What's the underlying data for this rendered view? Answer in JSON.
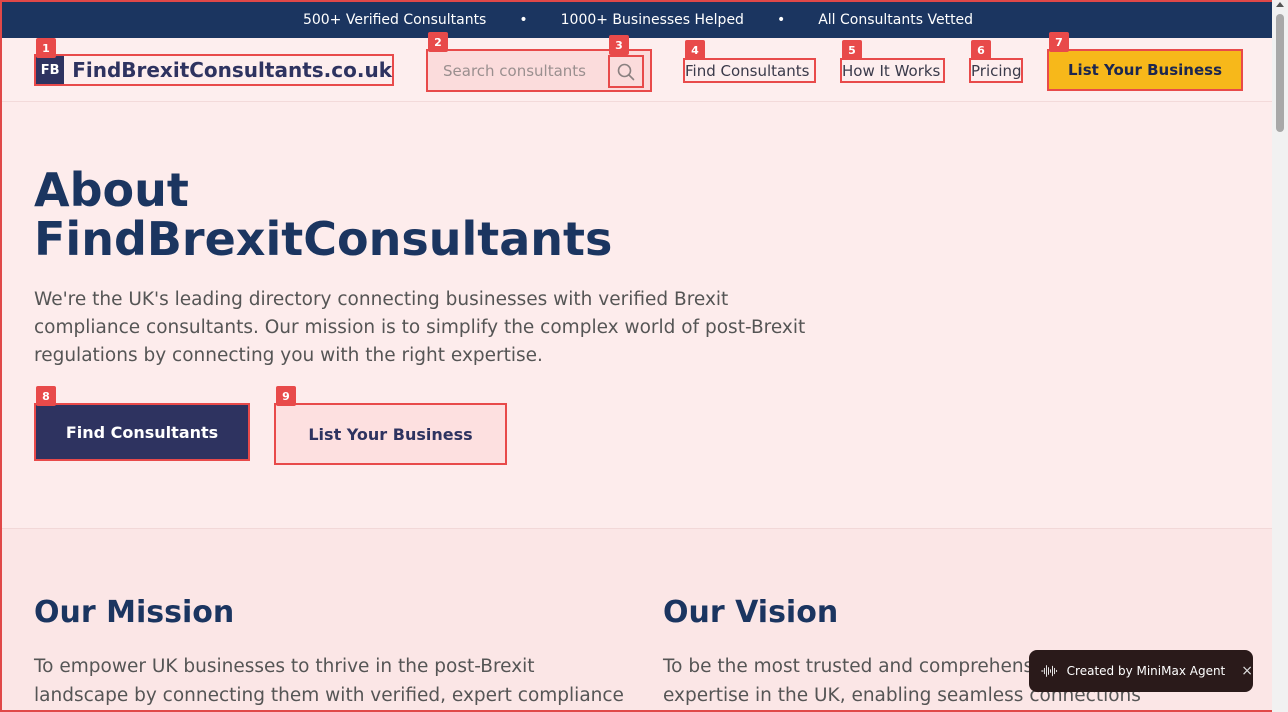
{
  "topbar": {
    "item1": "500+ Verified Consultants",
    "item2": "1000+ Businesses Helped",
    "item3": "All Consultants Vetted",
    "separator": "•"
  },
  "header": {
    "logo_mark": "FB",
    "logo_text": "FindBrexitConsultants.co.uk",
    "search_placeholder": "Search consultants",
    "nav": [
      "Find Consultants",
      "How It Works",
      "Pricing"
    ],
    "cta": "List Your Business"
  },
  "badges": [
    "1",
    "2",
    "3",
    "4",
    "5",
    "6",
    "7",
    "8",
    "9"
  ],
  "hero": {
    "title_line1": "About",
    "title_line2": "FindBrexitConsultants",
    "description": "We're the UK's leading directory connecting businesses with verified Brexit compliance consultants. Our mission is to simplify the complex world of post-Brexit regulations by connecting you with the right expertise.",
    "primary_button": "Find Consultants",
    "secondary_button": "List Your Business"
  },
  "mission": {
    "title": "Our Mission",
    "text": "To empower UK businesses to thrive in the post-Brexit landscape by connecting them with verified, expert compliance"
  },
  "vision": {
    "title": "Our Vision",
    "text": "To be the most trusted and comprehensive compliance expertise in the UK, enabling seamless connections"
  },
  "toast": {
    "text": "Created by MiniMax Agent",
    "close": "×"
  },
  "colors": {
    "navy": "#1b3560",
    "indigo": "#2e3360",
    "accent": "#f7b81a",
    "highlight": "#e84a4a",
    "background": "#fdecec"
  },
  "icons": [
    "search-icon",
    "close-icon",
    "waveform-icon"
  ]
}
